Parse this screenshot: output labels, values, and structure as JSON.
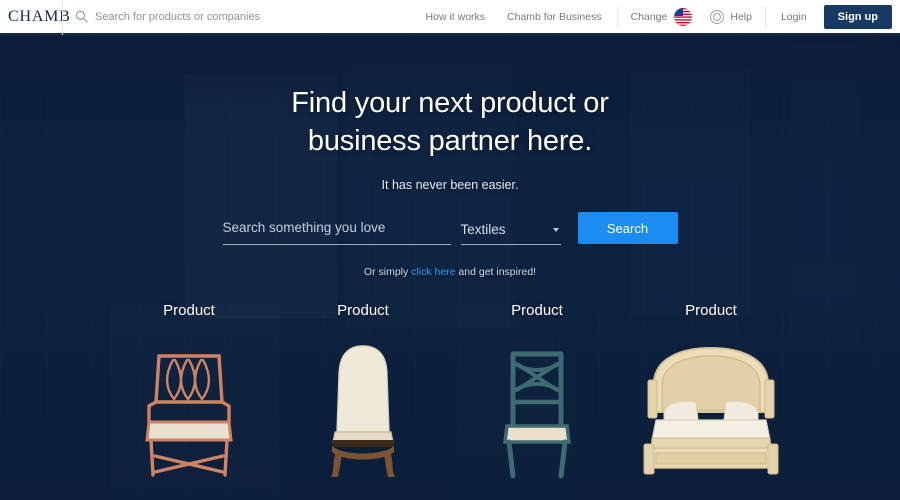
{
  "header": {
    "logo": "CHAMB",
    "search": {
      "placeholder": "Search for products or companies",
      "value": "",
      "icon": "search-icon"
    },
    "nav": [
      {
        "label": "How it works"
      },
      {
        "label": "Chamb for Business"
      }
    ],
    "change": {
      "label": "Change",
      "flag": "us-flag-icon"
    },
    "help": {
      "label": "Help",
      "icon": "help-circle-icon"
    },
    "login_label": "Login",
    "signup_label": "Sign up",
    "colors": {
      "signup_bg": "#173a63",
      "logo_color": "#14294a",
      "nav_text": "#73797f"
    }
  },
  "hero": {
    "title_line1": "Find your next product or",
    "title_line2": "business partner here.",
    "subtitle": "It has never been easier.",
    "search": {
      "keyword_placeholder": "Search something you love",
      "keyword_value": "",
      "category_value": "Textiles",
      "category_caret": "chevron-down-icon",
      "button_label": "Search"
    },
    "inspire": {
      "prefix": "Or simply ",
      "link": "click here",
      "suffix": " and get inspired!"
    },
    "colors": {
      "background": "#0d2240",
      "search_button": "#1c8df0",
      "link": "#2f9bf5"
    }
  },
  "products": [
    {
      "title": "Product",
      "icon": "armchair-icon",
      "color": "#d98b6a"
    },
    {
      "title": "Product",
      "icon": "side-chair-icon",
      "color": "#e9e1cf"
    },
    {
      "title": "Product",
      "icon": "teal-chair-icon",
      "color": "#3f6b72"
    },
    {
      "title": "Product",
      "icon": "bed-icon",
      "color": "#e8d9b6"
    }
  ]
}
